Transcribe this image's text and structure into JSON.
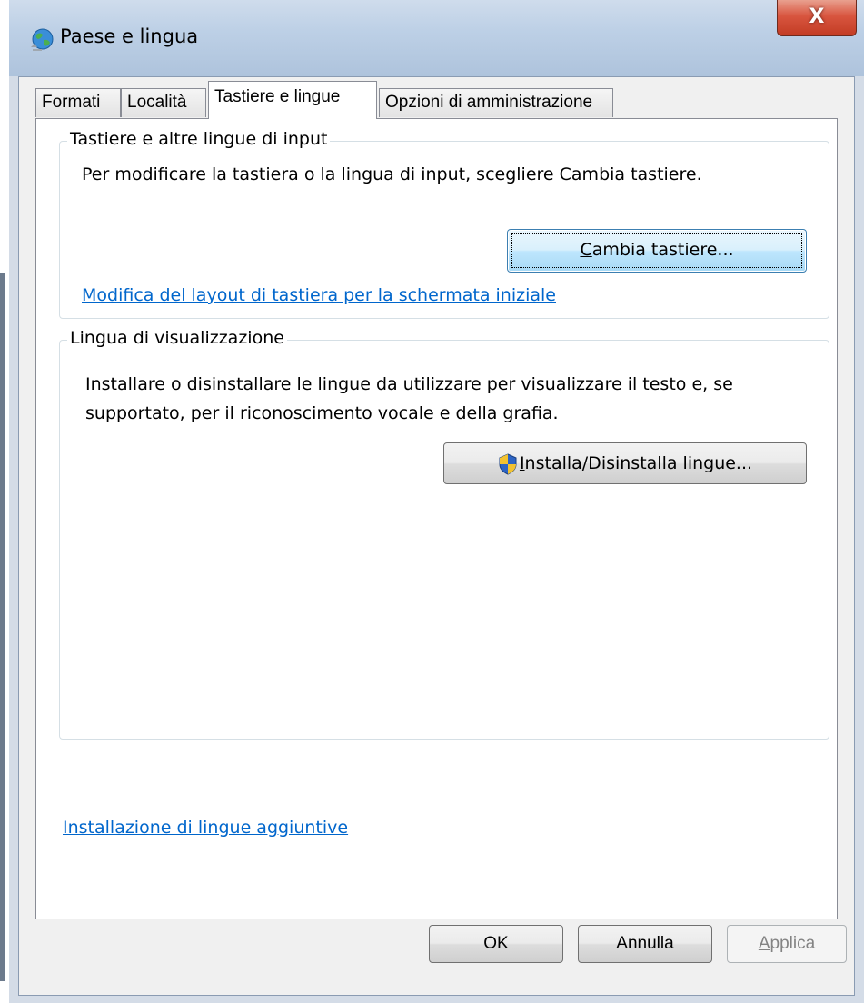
{
  "window": {
    "title": "Paese e lingua",
    "close_label": "X"
  },
  "tabs": [
    {
      "label": "Formati",
      "active": false
    },
    {
      "label": "Località",
      "active": false
    },
    {
      "label": "Tastiere e lingue",
      "active": true
    },
    {
      "label": "Opzioni di amministrazione",
      "active": false
    }
  ],
  "keyboards_group": {
    "title": "Tastiere e altre lingue di input",
    "description": "Per modificare la tastiera o la lingua di input, scegliere Cambia tastiere.",
    "button_mnemonic": "C",
    "button_rest": "ambia tastiere...",
    "link": "Modifica del layout di tastiera per la schermata iniziale"
  },
  "display_group": {
    "title": "Lingua di visualizzazione",
    "description_line1": "Installare o disinstallare le lingue da utilizzare per visualizzare il testo e, se",
    "description_line2": "supportato, per il riconoscimento vocale e della grafia.",
    "button_mnemonic": "I",
    "button_rest": "nstalla/Disinstalla lingue...",
    "shield_icon": "uac-shield-icon"
  },
  "bottom_link": "Installazione di lingue aggiuntive",
  "footer": {
    "ok_label": "OK",
    "cancel_label": "Annulla",
    "apply_mnemonic": "A",
    "apply_rest": "pplica"
  },
  "colors": {
    "link": "#0066cc",
    "close_button": "#c33c24",
    "default_button_border": "#3c7fb1"
  }
}
